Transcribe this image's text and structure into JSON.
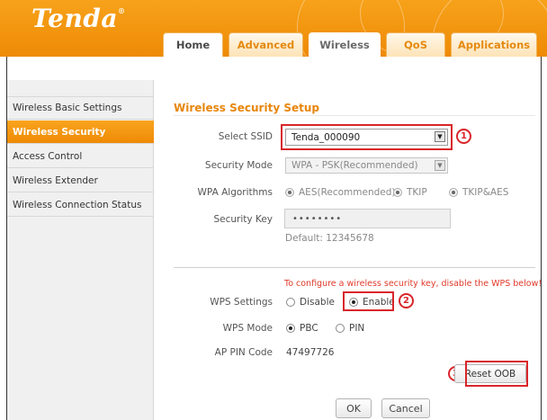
{
  "header": {
    "logo_text": "Tenda",
    "logo_mark": "®",
    "brand_color": "#f29312",
    "tabs": [
      {
        "label": "Home",
        "active": false
      },
      {
        "label": "Advanced",
        "active": false
      },
      {
        "label": "Wireless",
        "active": true
      },
      {
        "label": "QoS",
        "active": false
      },
      {
        "label": "Applications",
        "active": false
      }
    ]
  },
  "sidebar": {
    "items": [
      {
        "label": "Wireless Basic Settings",
        "active": false
      },
      {
        "label": "Wireless Security",
        "active": true
      },
      {
        "label": "Access Control",
        "active": false
      },
      {
        "label": "Wireless Extender",
        "active": false
      },
      {
        "label": "Wireless Connection Status",
        "active": false
      }
    ]
  },
  "main": {
    "title": "Wireless Security Setup",
    "ssid": {
      "label": "Select SSID",
      "value": "Tenda_000090"
    },
    "security_mode": {
      "label": "Security Mode",
      "value": "WPA - PSK(Recommended)"
    },
    "wpa_algorithms": {
      "label": "WPA Algorithms",
      "options": [
        "AES(Recommended)",
        "TKIP",
        "TKIP&AES"
      ],
      "selected": "AES(Recommended)"
    },
    "security_key": {
      "label": "Security Key",
      "value": "••••••••",
      "default_hint": "Default: 12345678"
    },
    "wps_warning": "To configure a wireless security key, disable the WPS below!",
    "wps_settings": {
      "label": "WPS Settings",
      "options": [
        "Disable",
        "Enable"
      ],
      "selected": "Enable"
    },
    "wps_mode": {
      "label": "WPS Mode",
      "options": [
        "PBC",
        "PIN"
      ],
      "selected": "PBC"
    },
    "ap_pin": {
      "label": "AP PIN Code",
      "value": "47497726"
    },
    "reset_button": "Reset OOB",
    "ok_button": "OK",
    "cancel_button": "Cancel"
  },
  "callouts": [
    "1",
    "2",
    "3"
  ],
  "colors": {
    "accent": "#e8860c",
    "callout_red": "#d9262a",
    "warning_red": "#e03a2a"
  }
}
